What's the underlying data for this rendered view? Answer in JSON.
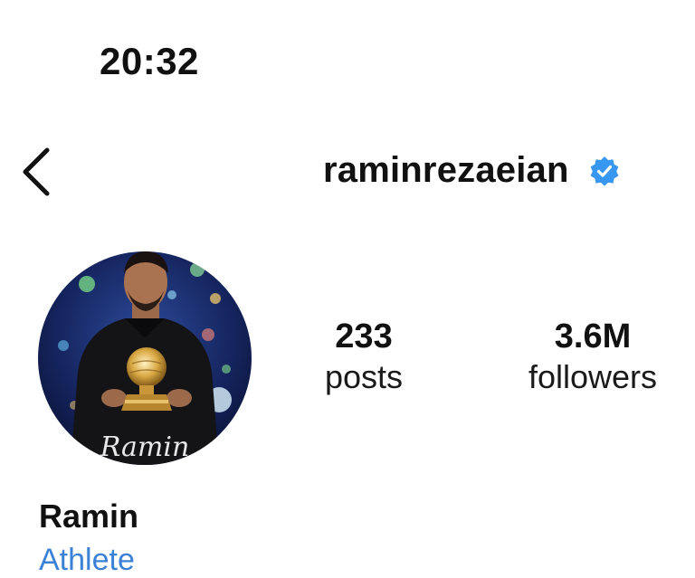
{
  "status_bar": {
    "time": "20:32"
  },
  "header": {
    "username": "raminrezaeian",
    "verified_color": "#3897f0"
  },
  "profile": {
    "display_name": "Ramin",
    "category": "Athlete",
    "avatar_signature": "Ramin"
  },
  "stats": [
    {
      "value": "233",
      "label": "posts"
    },
    {
      "value": "3.6M",
      "label": "followers"
    }
  ],
  "colors": {
    "text": "#111111",
    "accent_link": "#3b82d6",
    "verified": "#3897f0"
  }
}
